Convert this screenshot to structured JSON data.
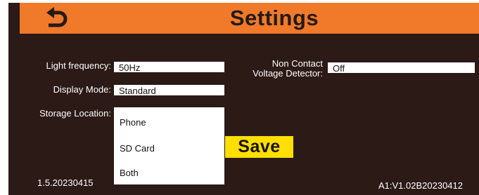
{
  "header": {
    "title": "Settings",
    "back_icon": "undo-arrow-icon",
    "color": "#f07a2a"
  },
  "settings": {
    "light_frequency": {
      "label": "Light frequency:",
      "value": "50Hz"
    },
    "display_mode": {
      "label": "Display Mode:",
      "value": "Standard"
    },
    "storage_location": {
      "label": "Storage Location:",
      "options": [
        "Phone",
        "SD Card",
        "Both"
      ]
    },
    "voltage_detector": {
      "label_line1": "Non Contact",
      "label_line2": "Voltage Detector:",
      "value": "Off"
    }
  },
  "save_label": "Save",
  "save_color": "#ffdf00",
  "footer": {
    "left_version": "1.5.20230415",
    "right_version": "A1:V1.02B20230412"
  }
}
